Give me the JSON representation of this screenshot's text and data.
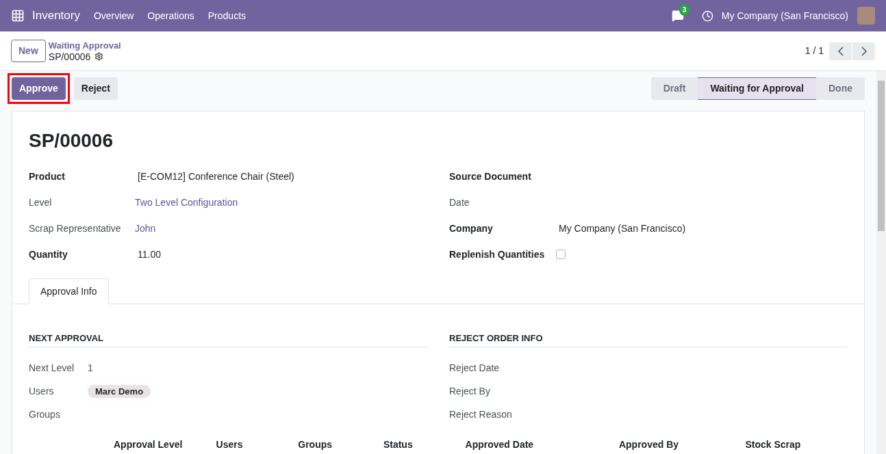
{
  "navbar": {
    "app_name": "Inventory",
    "menu": [
      "Overview",
      "Operations",
      "Products"
    ],
    "messages_count": "3",
    "company": "My Company (San Francisco)"
  },
  "control_panel": {
    "new_button": "New",
    "breadcrumb": "Waiting Approval",
    "record": "SP/00006",
    "pager": "1 / 1"
  },
  "actions": [
    {
      "label": "Approve",
      "kind": "primary",
      "highlighted": true
    },
    {
      "label": "Reject",
      "kind": "secondary",
      "highlighted": false
    }
  ],
  "status_steps": [
    {
      "label": "Draft",
      "selected": false
    },
    {
      "label": "Waiting for Approval",
      "selected": true
    },
    {
      "label": "Done",
      "selected": false
    }
  ],
  "sheet": {
    "title": "SP/00006",
    "left_fields": [
      {
        "label": "Product",
        "required": true,
        "kind": "text",
        "value": "[E-COM12] Conference Chair (Steel)"
      },
      {
        "label": "Level",
        "required": false,
        "kind": "link",
        "value": "Two Level Configuration"
      },
      {
        "label": "Scrap Representative",
        "required": false,
        "kind": "link",
        "value": "John"
      },
      {
        "label": "Quantity",
        "required": true,
        "kind": "text",
        "value": "11.00"
      }
    ],
    "right_fields": [
      {
        "label": "Source Document",
        "required": true,
        "kind": "text"
      },
      {
        "label": "Date",
        "required": false,
        "kind": "text"
      },
      {
        "label": "Company",
        "required": true,
        "kind": "text",
        "value": "My Company (San Francisco)"
      },
      {
        "label": "Replenish Quantities",
        "required": true,
        "kind": "checkbox",
        "checked": false
      }
    ],
    "tabs": [
      {
        "label": "Approval Info",
        "selected": true
      }
    ],
    "next_approval": {
      "title": "NEXT APPROVAL",
      "fields": [
        {
          "label": "Next Level",
          "kind": "text",
          "value": "1"
        },
        {
          "label": "Users",
          "kind": "tag",
          "value": "Marc Demo"
        },
        {
          "label": "Groups"
        }
      ]
    },
    "reject_info": {
      "title": "REJECT ORDER INFO",
      "fields": [
        {
          "label": "Reject Date"
        },
        {
          "label": "Reject By"
        },
        {
          "label": "Reject Reason"
        }
      ]
    },
    "table": {
      "columns": [
        "Approval Level",
        "Users",
        "Groups",
        "Status",
        "Approved Date",
        "Approved By",
        "Stock Scrap"
      ]
    }
  }
}
